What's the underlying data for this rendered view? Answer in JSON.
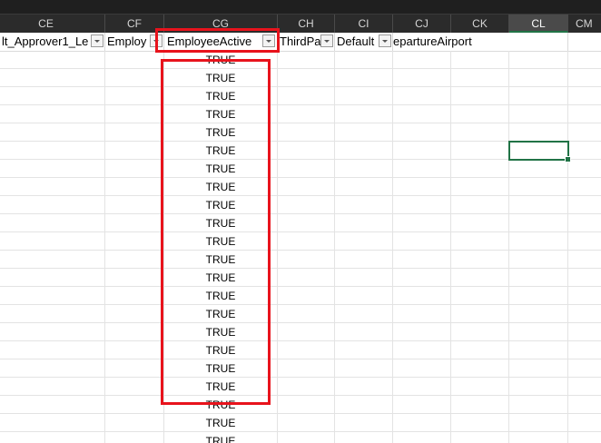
{
  "columns": [
    {
      "letter": "CE"
    },
    {
      "letter": "CF"
    },
    {
      "letter": "CG"
    },
    {
      "letter": "CH"
    },
    {
      "letter": "CI"
    },
    {
      "letter": "CJ"
    },
    {
      "letter": "CK"
    },
    {
      "letter": "CL",
      "selected": true
    },
    {
      "letter": "CM"
    }
  ],
  "header_row": {
    "ce": "lt_Approver1_Le",
    "cf": "Employ",
    "cg": "EmployeeActive",
    "ch": "ThirdPa",
    "ci": "Default",
    "cj": "epartureAirport"
  },
  "cg_values": [
    "TRUE",
    "TRUE",
    "TRUE",
    "TRUE",
    "TRUE",
    "TRUE",
    "TRUE",
    "TRUE",
    "TRUE",
    "TRUE",
    "TRUE",
    "TRUE",
    "TRUE",
    "TRUE",
    "TRUE",
    "TRUE",
    "TRUE",
    "TRUE",
    "TRUE",
    "TRUE",
    "TRUE",
    "TRUE"
  ],
  "annotation_color": "#e8131c",
  "selection_color": "#217346"
}
